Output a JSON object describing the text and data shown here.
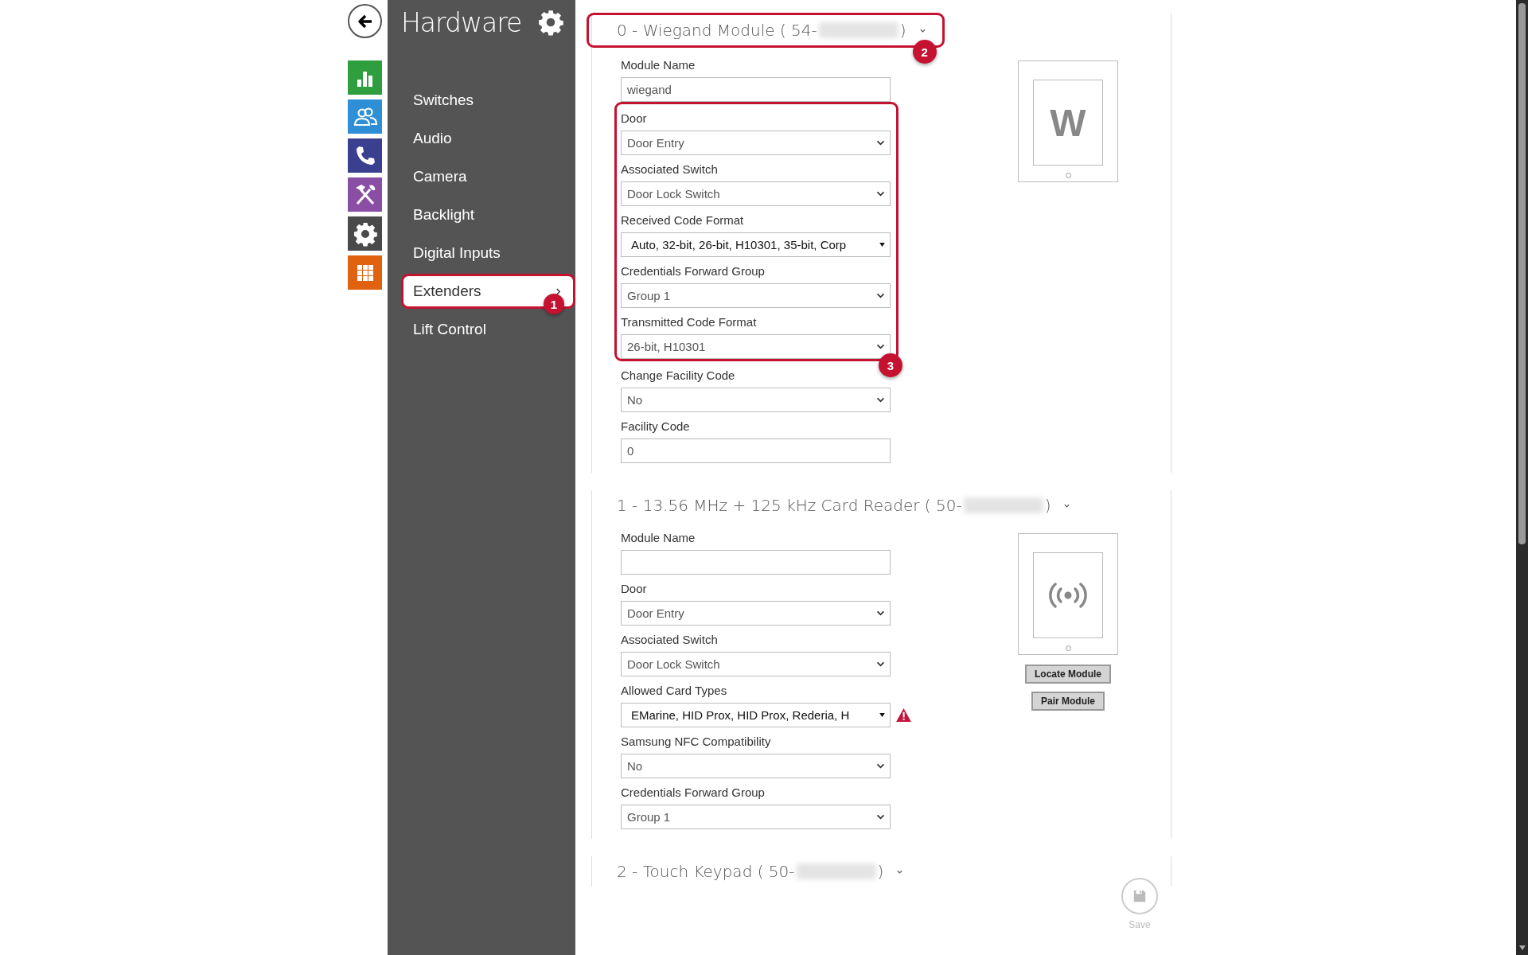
{
  "rail": {
    "items": [
      {
        "kind": "chart",
        "color": "#2f9e3f"
      },
      {
        "kind": "users",
        "color": "#2f8fd6"
      },
      {
        "kind": "phone",
        "color": "#3a3f8f"
      },
      {
        "kind": "tools",
        "color": "#8a4fa5"
      },
      {
        "kind": "gear",
        "color": "#4a4a4a"
      },
      {
        "kind": "grid",
        "color": "#e0620e"
      }
    ]
  },
  "sidebar": {
    "title": "Hardware",
    "items": [
      {
        "label": "Switches",
        "selected": false
      },
      {
        "label": "Audio",
        "selected": false
      },
      {
        "label": "Camera",
        "selected": false
      },
      {
        "label": "Backlight",
        "selected": false
      },
      {
        "label": "Digital Inputs",
        "selected": false
      },
      {
        "label": "Extenders",
        "selected": true,
        "callout": "1"
      },
      {
        "label": "Lift Control",
        "selected": false
      }
    ]
  },
  "modules": [
    {
      "title": "0 - Wiegand Module ( 54-",
      "title_end": ")",
      "callout": "2",
      "image": {
        "kind": "letter",
        "text": "W"
      },
      "field_groups": [
        {
          "fields": [
            {
              "label": "Module Name",
              "kind": "text",
              "value": "wiegand"
            }
          ]
        },
        {
          "callout": "3",
          "fields": [
            {
              "label": "Door",
              "kind": "select",
              "value": "Door Entry"
            },
            {
              "label": "Associated Switch",
              "kind": "select",
              "value": "Door Lock Switch"
            },
            {
              "label": "Received Code Format",
              "kind": "multiselect",
              "value": "Auto, 32-bit, 26-bit, H10301, 35-bit, Corp"
            },
            {
              "label": "Credentials Forward Group",
              "kind": "select",
              "value": "Group 1"
            },
            {
              "label": "Transmitted Code Format",
              "kind": "select",
              "value": "26-bit, H10301"
            }
          ]
        },
        {
          "fields": [
            {
              "label": "Change Facility Code",
              "kind": "select",
              "value": "No"
            },
            {
              "label": "Facility Code",
              "kind": "text",
              "value": "0"
            }
          ]
        }
      ]
    },
    {
      "title": "1 - 13.56 MHz + 125 kHz Card Reader ( 50-",
      "title_end": ")",
      "image": {
        "kind": "wireless"
      },
      "buttons": [
        "Locate Module",
        "Pair Module"
      ],
      "field_groups": [
        {
          "fields": [
            {
              "label": "Module Name",
              "kind": "text"
            },
            {
              "label": "Door",
              "kind": "select",
              "value": "Door Entry"
            },
            {
              "label": "Associated Switch",
              "kind": "select",
              "value": "Door Lock Switch"
            },
            {
              "label": "Allowed Card Types",
              "kind": "multiselect",
              "value": "EMarine, HID Prox, HID Prox, Rederia, H",
              "warning": true
            },
            {
              "label": "Samsung NFC Compatibility",
              "kind": "select",
              "value": "No"
            },
            {
              "label": "Credentials Forward Group",
              "kind": "select",
              "value": "Group 1"
            }
          ]
        }
      ]
    },
    {
      "title": "2 - Touch Keypad ( 50-",
      "title_end": ")"
    }
  ],
  "save": {
    "label": "Save",
    "disabled": true
  }
}
